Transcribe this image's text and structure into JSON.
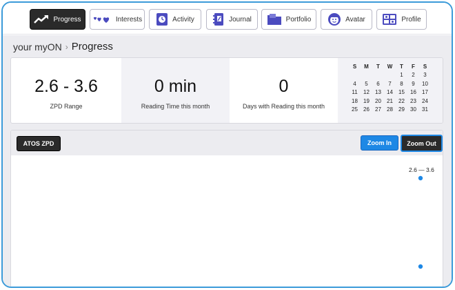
{
  "nav": {
    "tabs": [
      {
        "label": "Progress",
        "icon": "trend-up-icon",
        "active": true
      },
      {
        "label": "Interests",
        "icon": "hearts-icon",
        "active": false
      },
      {
        "label": "Activity",
        "icon": "clock-badge-icon",
        "active": false
      },
      {
        "label": "Journal",
        "icon": "notebook-icon",
        "active": false
      },
      {
        "label": "Portfolio",
        "icon": "folder-icon",
        "active": false
      },
      {
        "label": "Avatar",
        "icon": "avatar-face-icon",
        "active": false
      },
      {
        "label": "Profile",
        "icon": "profile-grid-icon",
        "active": false
      }
    ]
  },
  "breadcrumb": {
    "root": "your myON",
    "separator": "›",
    "current": "Progress"
  },
  "stats": [
    {
      "value": "2.6 - 3.6",
      "label": "ZPD Range"
    },
    {
      "value": "0 min",
      "label": "Reading Time this month"
    },
    {
      "value": "0",
      "label": "Days with Reading this month"
    }
  ],
  "calendar": {
    "weekdays": [
      "S",
      "M",
      "T",
      "W",
      "T",
      "F",
      "S"
    ],
    "weeks": [
      [
        "",
        "",
        "",
        "",
        "1",
        "2",
        "3"
      ],
      [
        "4",
        "5",
        "6",
        "7",
        "8",
        "9",
        "10"
      ],
      [
        "11",
        "12",
        "13",
        "14",
        "15",
        "16",
        "17"
      ],
      [
        "18",
        "19",
        "20",
        "21",
        "22",
        "23",
        "24"
      ],
      [
        "25",
        "26",
        "27",
        "28",
        "29",
        "30",
        "31"
      ]
    ]
  },
  "chart": {
    "metric_button": "ATOS ZPD",
    "zoom_in": "Zoom In",
    "zoom_out": "Zoom Out",
    "range_label": "2.6 — 3.6",
    "point_color": "#1e88e5"
  }
}
